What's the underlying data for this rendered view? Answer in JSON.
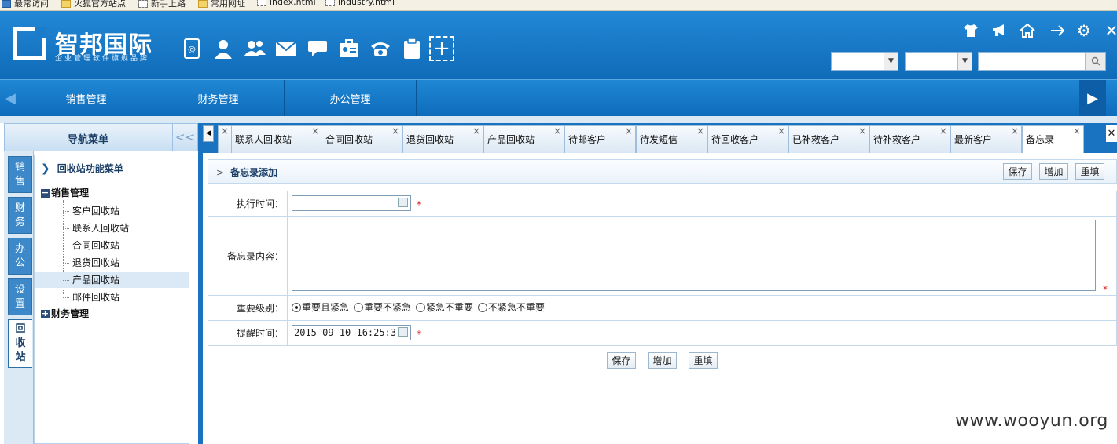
{
  "browser": {
    "bookmarks": [
      {
        "label": "最常访问",
        "icon": "page-icon"
      },
      {
        "label": "火狐官方站点",
        "icon": "folder-icon"
      },
      {
        "label": "新手上路",
        "icon": "page-icon"
      },
      {
        "label": "常用网址",
        "icon": "folder-icon"
      },
      {
        "label": "index.html",
        "icon": "page-icon"
      },
      {
        "label": "industry.html",
        "icon": "page-icon"
      }
    ]
  },
  "header": {
    "brand": "智邦国际",
    "slogan": "企业管理软件旗舰品牌",
    "toolbar_icons": [
      "address-book-icon",
      "user-icon",
      "users-icon",
      "mail-icon",
      "chat-icon",
      "id-card-icon",
      "phone-icon",
      "clipboard-icon",
      "add-icon"
    ],
    "top_icons": [
      "shirt-icon",
      "megaphone-icon",
      "home-icon",
      "arrow-right-icon",
      "gear-icon",
      "close-icon"
    ],
    "select1_value": "",
    "select2_value": "",
    "search_value": ""
  },
  "nav": {
    "tabs": [
      "销售管理",
      "财务管理",
      "办公管理"
    ]
  },
  "sidebar": {
    "title": "导航菜单",
    "collapse_glyph": "<<",
    "vtabs": [
      "销售",
      "财务",
      "办公",
      "设置",
      "回收站"
    ],
    "tree_root": "回收站功能菜单",
    "groups": [
      {
        "label": "销售管理",
        "expanded": true,
        "items": [
          "客户回收站",
          "联系人回收站",
          "合同回收站",
          "退货回收站",
          "产品回收站",
          "邮件回收站"
        ],
        "selected": "产品回收站"
      },
      {
        "label": "财务管理",
        "expanded": false
      }
    ]
  },
  "tabs": [
    "联系人回收站",
    "合同回收站",
    "退货回收站",
    "产品回收站",
    "待邮客户",
    "待发短信",
    "待回收客户",
    "已补救客户",
    "待补救客户",
    "最新客户",
    "备忘录"
  ],
  "active_tab": "备忘录",
  "panel": {
    "title": "备忘录添加",
    "buttons": {
      "save": "保存",
      "add": "增加",
      "reset": "重填"
    }
  },
  "form": {
    "exec_time_label": "执行时间：",
    "exec_time_value": "",
    "content_label": "备忘录内容：",
    "content_value": "",
    "level_label": "重要级别：",
    "levels": [
      "重要且紧急",
      "重要不紧急",
      "紧急不重要",
      "不紧急不重要"
    ],
    "level_selected": "重要且紧急",
    "remind_label": "提醒时间：",
    "remind_value": "2015-09-10 16:25:37",
    "required_mark": "*"
  },
  "footer_buttons": {
    "save": "保存",
    "add": "增加",
    "reset": "重填"
  },
  "watermark": "www.wooyun.org"
}
